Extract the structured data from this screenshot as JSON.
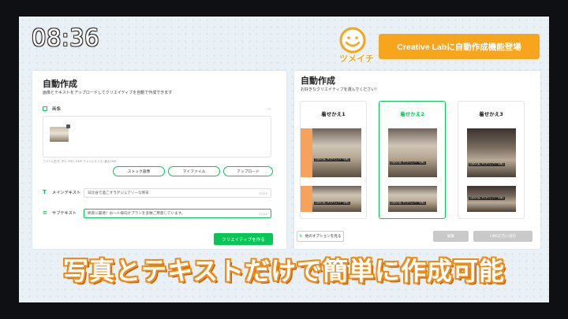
{
  "clock": "08:36",
  "banner": {
    "text": "Creative Labに自動作成機能登場",
    "color": "#f6a51c"
  },
  "mascot": {
    "icon": "smiley-mascot-icon",
    "text": "ツメイチ"
  },
  "left": {
    "title": "自動作成",
    "subtitle": "画像とテキストをアップロードしてクリエイティブを自動で作成できます",
    "image_section_label": "画像",
    "image_hint": "ファイル形式: JPG, PNG, BMP   ファイルサイズ: 最大5MB",
    "buttons": {
      "stock": "ストック画像",
      "my_file": "マイファイル",
      "upload": "アップロード"
    },
    "main_text": {
      "label": "メインテキスト",
      "value": "日比谷で過ごすラグジュアリーな休日",
      "counter": "17/20"
    },
    "sub_text": {
      "label": "サブテキスト",
      "value": "絶景に最適！お一人様向けプランを多数ご用意しています。",
      "counter": "27/40"
    },
    "create_button": "クリエイティブを作る",
    "accent": "#06c755"
  },
  "right": {
    "title": "自動作成",
    "subtitle": "お好きなクリエイティブを選んでください！",
    "cards": [
      {
        "label": "着せかえ1",
        "selected": false,
        "caption": "日比谷で過ごすラグジュアリーな休日"
      },
      {
        "label": "着せかえ2",
        "selected": true,
        "caption": "日比谷で過ごすラグジュアリーな休日"
      },
      {
        "label": "着せかえ3",
        "selected": false,
        "caption": "日比谷で過ごすラグジュアリーな休日"
      }
    ],
    "other_options": "他のオプションを見る",
    "edit_button": "編集",
    "line_button": "LINE広告に送信"
  },
  "caption": "写真とテキストだけで簡単に作成可能"
}
